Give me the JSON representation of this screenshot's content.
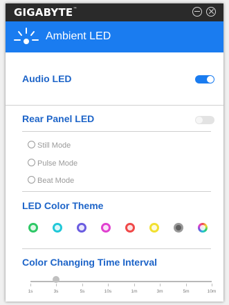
{
  "window": {
    "brand": "GIGABYTE",
    "brand_mark": "™"
  },
  "header": {
    "title": "Ambient LED",
    "icon": "led-burst-icon"
  },
  "audio_led": {
    "label": "Audio LED",
    "enabled": true
  },
  "rear_panel_led": {
    "label": "Rear Panel LED",
    "enabled": false,
    "modes": [
      {
        "label": "Still Mode",
        "selected": false
      },
      {
        "label": "Pulse Mode",
        "selected": false
      },
      {
        "label": "Beat Mode",
        "selected": false
      }
    ]
  },
  "color_theme": {
    "label": "LED Color Theme",
    "colors": [
      "#2ec866",
      "#20c8d8",
      "#6a5ce0",
      "#e040d0",
      "#f04848",
      "#f2e030",
      "#9a9a9a",
      "rainbow"
    ]
  },
  "interval": {
    "label": "Color Changing Time Interval",
    "ticks": [
      "1s",
      "3s",
      "5s",
      "10s",
      "1m",
      "3m",
      "5m",
      "10m"
    ],
    "selected": "3s"
  },
  "colors": {
    "accent": "#1a7cf0",
    "section_title": "#1d64c8",
    "titlebar": "#2a2a2a"
  }
}
